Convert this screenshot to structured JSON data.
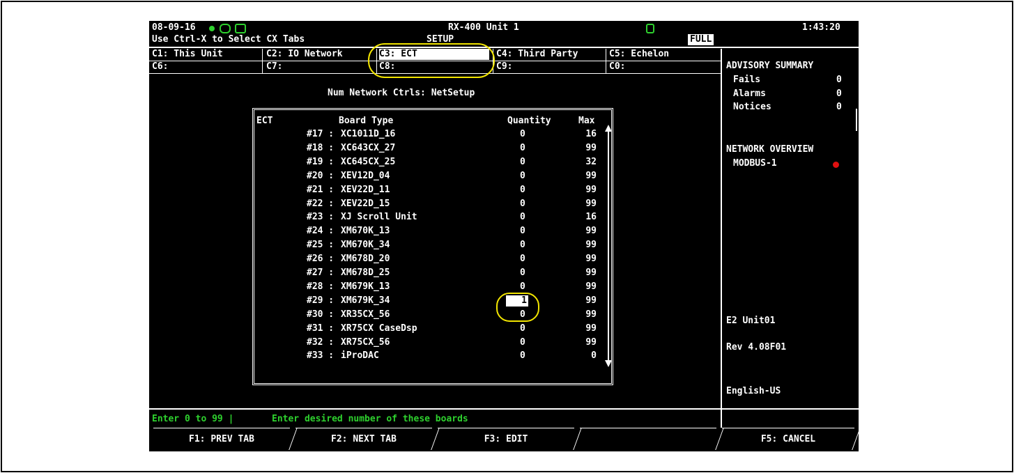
{
  "header": {
    "date": "08-09-16",
    "title": "RX-400 Unit 1",
    "time": "1:43:20",
    "hint": "Use Ctrl-X to Select CX Tabs",
    "mode": "SETUP",
    "full_badge": "FULL"
  },
  "tabs_row1": [
    "C1: This Unit",
    "C2: IO Network",
    "C3: ECT",
    "C4: Third Party",
    "C5: Echelon"
  ],
  "tabs_row2": [
    "C6:",
    "C7:",
    "C8:",
    "C9:",
    "C0:"
  ],
  "selected_tab": "C3: ECT",
  "subtitle": "Num Network Ctrls: NetSetup",
  "table": {
    "section": "ECT",
    "col_board": "Board Type",
    "col_qty": "Quantity",
    "col_max": "Max",
    "rows": [
      {
        "num": "#17 :",
        "board": "XC1011D_16",
        "qty": "0",
        "max": "16"
      },
      {
        "num": "#18 :",
        "board": "XC643CX_27",
        "qty": "0",
        "max": "99"
      },
      {
        "num": "#19 :",
        "board": "XC645CX_25",
        "qty": "0",
        "max": "32"
      },
      {
        "num": "#20 :",
        "board": "XEV12D_04",
        "qty": "0",
        "max": "99"
      },
      {
        "num": "#21 :",
        "board": "XEV22D_11",
        "qty": "0",
        "max": "99"
      },
      {
        "num": "#22 :",
        "board": "XEV22D_15",
        "qty": "0",
        "max": "99"
      },
      {
        "num": "#23 :",
        "board": "XJ Scroll Unit",
        "qty": "0",
        "max": "16"
      },
      {
        "num": "#24 :",
        "board": "XM670K_13",
        "qty": "0",
        "max": "99"
      },
      {
        "num": "#25 :",
        "board": "XM670K_34",
        "qty": "0",
        "max": "99"
      },
      {
        "num": "#26 :",
        "board": "XM678D_20",
        "qty": "0",
        "max": "99"
      },
      {
        "num": "#27 :",
        "board": "XM678D_25",
        "qty": "0",
        "max": "99"
      },
      {
        "num": "#28 :",
        "board": "XM679K_13",
        "qty": "0",
        "max": "99"
      },
      {
        "num": "#29 :",
        "board": "XM679K_34",
        "qty": "1",
        "max": "99"
      },
      {
        "num": "#30 :",
        "board": "XR35CX_56",
        "qty": "0",
        "max": "99"
      },
      {
        "num": "#31 :",
        "board": "XR75CX CaseDsp",
        "qty": "0",
        "max": "99"
      },
      {
        "num": "#32 :",
        "board": "XR75CX_56",
        "qty": "0",
        "max": "99"
      },
      {
        "num": "#33 :",
        "board": "iProDAC",
        "qty": "0",
        "max": "0"
      }
    ]
  },
  "advisory": {
    "title": "ADVISORY SUMMARY",
    "items": [
      {
        "label": "Fails",
        "value": "0"
      },
      {
        "label": "Alarms",
        "value": "0"
      },
      {
        "label": "Notices",
        "value": "0"
      }
    ]
  },
  "network": {
    "title": "NETWORK OVERVIEW",
    "item": "MODBUS-1",
    "status_color": "#e01010"
  },
  "unit_info": {
    "unit": "E2 Unit01",
    "rev": "Rev 4.08F01",
    "lang": "English-US"
  },
  "status_line": {
    "range": "Enter 0 to 99 |",
    "hint": "Enter desired number of these boards"
  },
  "fkeys": {
    "f1": "F1: PREV TAB",
    "f2": "F2: NEXT TAB",
    "f3": "F3: EDIT",
    "f4": "",
    "f5": "F5: CANCEL"
  },
  "colors": {
    "highlight_oval": "#f2e500",
    "status_green": "#2ed12e"
  }
}
